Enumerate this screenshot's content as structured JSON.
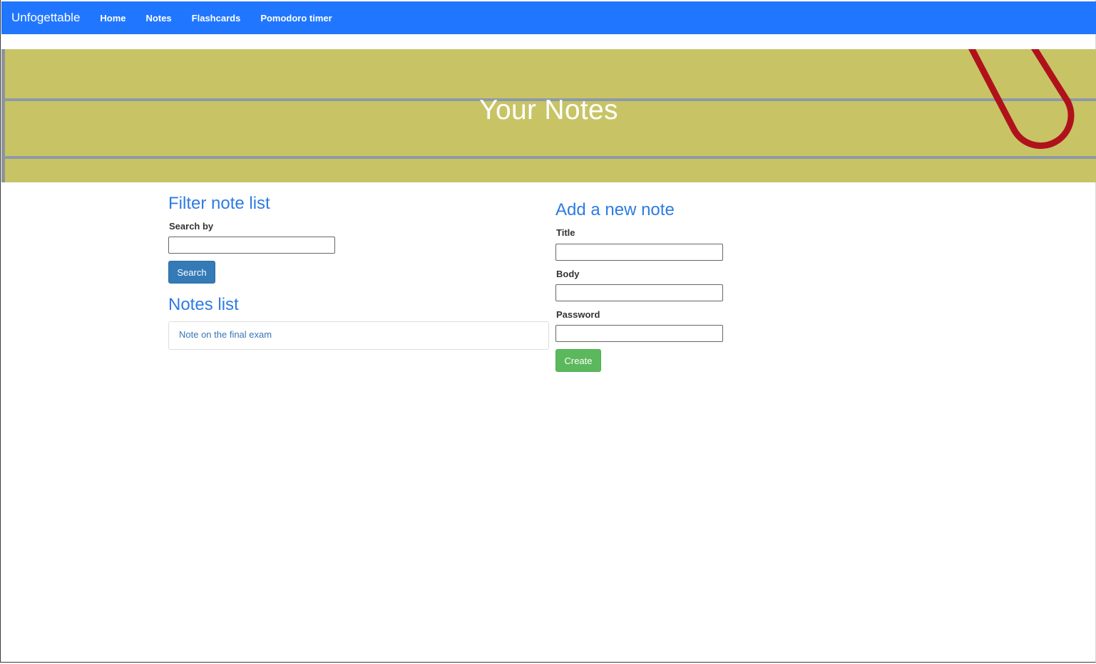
{
  "navbar": {
    "brand": "Unfogettable",
    "links": [
      "Home",
      "Notes",
      "Flashcards",
      "Pomodoro timer"
    ],
    "color": "#2176ff"
  },
  "banner": {
    "title": "Your Notes",
    "background": "#c8c466",
    "decoration": "paperclip"
  },
  "filter": {
    "heading": "Filter note list",
    "search_label": "Search by",
    "search_value": "",
    "search_button": "Search"
  },
  "notes_list": {
    "heading": "Notes list",
    "items": [
      "Note on the final exam"
    ]
  },
  "new_note": {
    "heading": "Add a new note",
    "title_label": "Title",
    "title_value": "",
    "body_label": "Body",
    "body_value": "",
    "password_label": "Password",
    "password_value": "",
    "create_button": "Create"
  },
  "colors": {
    "heading": "#2e7be3",
    "search_button": "#337ab7",
    "create_button": "#5cb85c"
  }
}
